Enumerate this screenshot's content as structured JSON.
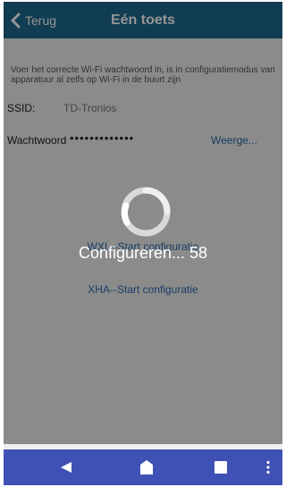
{
  "header": {
    "back_label": "Terug",
    "title": "Eén toets"
  },
  "form": {
    "instruction": "Voer het correcte Wi-Fi wachtwoord in, is in configuratiemodus van apparatuur al zelfs op Wi-Fi in de buurt zijn",
    "ssid_label": "SSID:",
    "ssid_value": "TD-Tronios",
    "password_label": "Wachtwoord",
    "password_value": "•••••••••••••",
    "show_label": "Weerge..."
  },
  "actions": {
    "wxl_label": "WXL--Start configuratie",
    "xha_label": "XHA--Start configuratie"
  },
  "overlay": {
    "loading_text": "Configureren... 58"
  },
  "colors": {
    "appbar": "#1e6a8d",
    "navbar": "#3f51b5",
    "link": "#2b6cb0"
  },
  "icons": {
    "back": "chevron-left-icon",
    "spinner": "loading-spinner-icon",
    "nav_back": "triangle-back-icon",
    "nav_home": "home-icon",
    "nav_recent": "square-recent-icon",
    "nav_more": "more-vertical-icon"
  }
}
